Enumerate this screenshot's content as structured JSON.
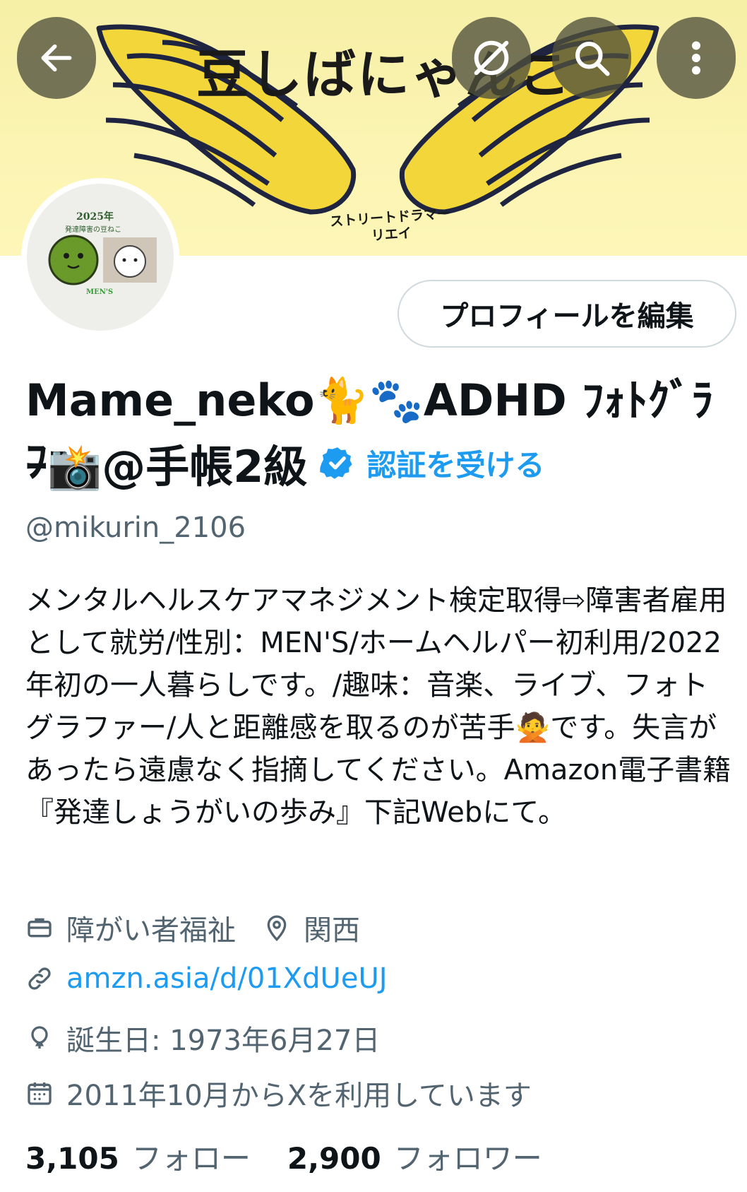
{
  "banner": {
    "title": "豆しばにゃんこ",
    "subtitle_line1": "ストリートドラマー",
    "subtitle_line2": "リエイ"
  },
  "nav": {
    "back_icon": "arrow-left-icon",
    "edit_image_icon": "slash-circle-icon",
    "search_icon": "search-icon",
    "more_icon": "vertical-dots-icon"
  },
  "avatar": {
    "year": "2025年",
    "line": "発達障害の豆ねこ",
    "mens": "MEN'S"
  },
  "profile": {
    "edit_button": "プロフィールを編集",
    "name_line1": "Mame_neko🐈🐾ADHD ﾌｫﾄｸﾞﾗﾌｧ",
    "name_line2": "ｰ📸@手帳2級",
    "get_verified": "認証を受ける",
    "handle": "@mikurin_2106",
    "bio": "メンタルヘルスケアマネジメント検定取得⇨障害者雇用として就労/性別：MEN'S/ホームヘルパー初利用/2022年初の一人暮らしです。/趣味：音楽、ライブ、フォトグラファー/人と距離感を取るのが苦手🙅です。失言があったら遠慮なく指摘してください。Amazon電子書籍『発達しょうがいの歩み』下記Webにて。"
  },
  "meta": {
    "category": "障がい者福祉",
    "location": "関西",
    "url": "amzn.asia/d/01XdUeUJ",
    "birthday": "誕生日: 1973年6月27日",
    "joined": "2011年10月からXを利用しています"
  },
  "stats": {
    "following_count": "3,105",
    "following_label": "フォロー",
    "followers_count": "2,900",
    "followers_label": "フォロワー"
  },
  "colors": {
    "accent": "#1d9bf0",
    "secondary_text": "#536471",
    "primary_text": "#0f1419",
    "banner_bg": "#fbf4b2",
    "wing_yellow": "#f2d63a"
  }
}
